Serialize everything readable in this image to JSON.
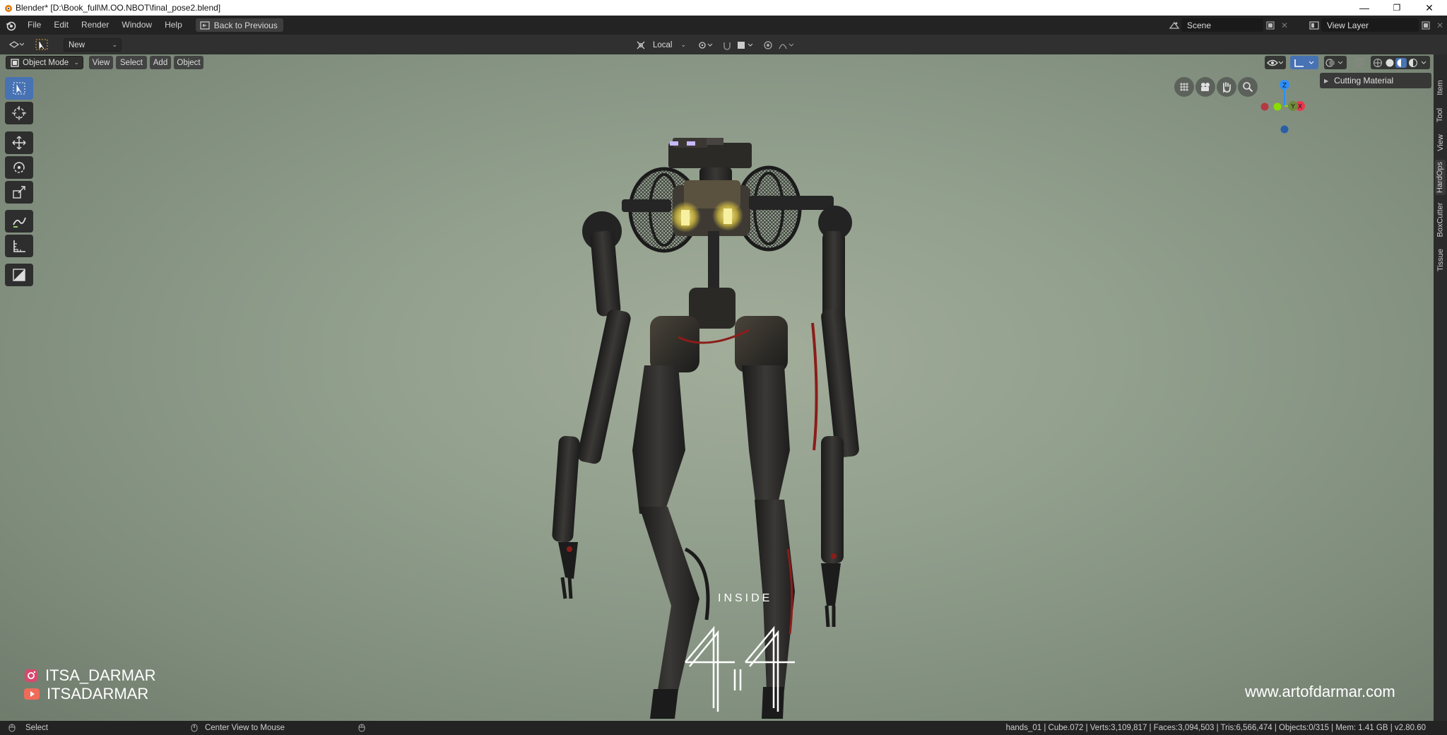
{
  "titlebar": {
    "title": "Blender* [D:\\Book_full\\M.OO.NBOT\\final_pose2.blend]",
    "minimize": "—",
    "restore": "❐",
    "close": "✕"
  },
  "menubar": {
    "items": [
      "File",
      "Edit",
      "Render",
      "Window",
      "Help"
    ],
    "back_label": "Back to Previous",
    "scene_value": "Scene",
    "view_layer_value": "View Layer"
  },
  "header": {
    "new_label": "New",
    "transform_orientation": "Local"
  },
  "viewport_header": {
    "mode": "Object Mode",
    "menus": [
      "View",
      "Select",
      "Add",
      "Object"
    ]
  },
  "panel": {
    "cutting_material": "Cutting Material"
  },
  "sidebar_tabs": [
    "Item",
    "Tool",
    "View",
    "HardOps",
    "BoxCutter",
    "Tissue"
  ],
  "gizmo": {
    "z": "Z",
    "y": "Y",
    "x": "X"
  },
  "overlay": {
    "instagram": "ITSA_DARMAR",
    "youtube": "ITSADARMAR",
    "inside": "INSIDE",
    "website": "www.artofdarmar.com"
  },
  "statusbar": {
    "select": "Select",
    "center_view": "Center View to Mouse",
    "stats": "hands_01 | Cube.072 | Verts:3,109,817 | Faces:3,094,503 | Tris:6,566,474 | Objects:0/315 | Mem: 1.41 GB | v2.80.60"
  },
  "colors": {
    "accent": "#4772b3",
    "axis_x": "#e8384f",
    "axis_y": "#8bdc00",
    "axis_z": "#2c8fff",
    "viewport_bg": "#93a08e"
  }
}
